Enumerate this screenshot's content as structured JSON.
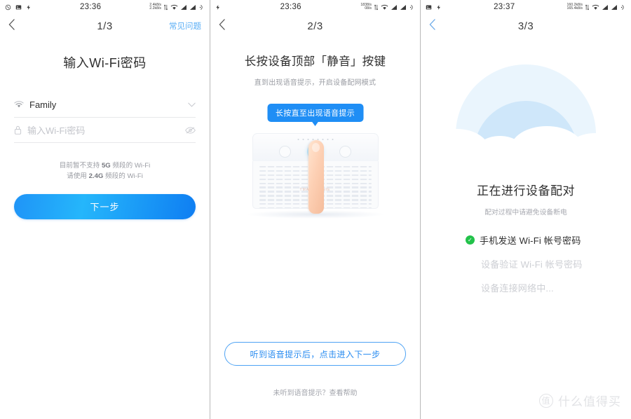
{
  "colors": {
    "accent": "#1f8ef5",
    "link": "#5aaef5",
    "success": "#22c24a",
    "muted": "#9a9ca3",
    "pending": "#cdcfd4"
  },
  "panel1": {
    "statusbar": {
      "time": "23:36",
      "rate_down": "2.4k8/s",
      "rate_up": "2.2k8/s",
      "icons_left": [
        "mute-icon",
        "photo-icon",
        "bolt-icon"
      ],
      "icons_right": [
        "data-transfer-icon",
        "wifi-icon",
        "signal-icon",
        "signal-icon",
        "alarm-icon"
      ]
    },
    "nav": {
      "back": "back-chevron-icon",
      "title": "1/3",
      "action": "常见问题"
    },
    "title": "输入Wi-Fi密码",
    "ssid_field": {
      "icon": "wifi-icon",
      "value": "Family",
      "chevron": "chevron-down-icon"
    },
    "password_field": {
      "icon": "lock-icon",
      "placeholder": "输入Wi-Fi密码",
      "value": "",
      "toggle": "eye-off-icon"
    },
    "hint_line1_pre": "目前暂不支持 ",
    "hint_line1_bold": "5G",
    "hint_line1_post": " 频段的 Wi-Fi",
    "hint_line2_pre": "请使用 ",
    "hint_line2_bold": "2.4G",
    "hint_line2_post": " 频段的 Wi-Fi",
    "next_button": "下一步"
  },
  "panel2": {
    "statusbar": {
      "time": "23:36",
      "rate_down": "1838/s",
      "rate_up": "08/s",
      "icons_left": [
        "bolt-icon"
      ],
      "icons_right": [
        "data-transfer-icon",
        "wifi-icon",
        "signal-icon",
        "signal-icon",
        "alarm-icon"
      ]
    },
    "nav": {
      "back": "back-chevron-icon",
      "title": "2/3",
      "action": ""
    },
    "title": "长按设备顶部「静音」按键",
    "subtitle": "直到出现语音提示，开启设备配网模式",
    "tooltip": "长按直至出现语音提示",
    "device_brand": "TMALL GENIE",
    "next_button": "听到语音提示后，点击进入下一步",
    "help_link": "未听到语音提示？查看帮助"
  },
  "panel3": {
    "statusbar": {
      "time": "23:37",
      "rate_down": "160.2k8/s",
      "rate_up": "165.4k8/s",
      "icons_left": [
        "photo-icon",
        "bolt-icon"
      ],
      "icons_right": [
        "data-transfer-icon",
        "wifi-icon",
        "signal-icon",
        "signal-icon",
        "alarm-icon"
      ]
    },
    "nav": {
      "back": "back-chevron-icon",
      "title": "3/3",
      "action": ""
    },
    "title": "正在进行设备配对",
    "subtitle": "配对过程中请避免设备断电",
    "steps": [
      {
        "label": "手机发送 Wi-Fi 帐号密码",
        "state": "done"
      },
      {
        "label": "设备验证 Wi-Fi 帐号密码",
        "state": "pending"
      },
      {
        "label": "设备连接网络中...",
        "state": "pending"
      }
    ],
    "watermark": {
      "badge": "值",
      "text": "什么值得买"
    }
  }
}
